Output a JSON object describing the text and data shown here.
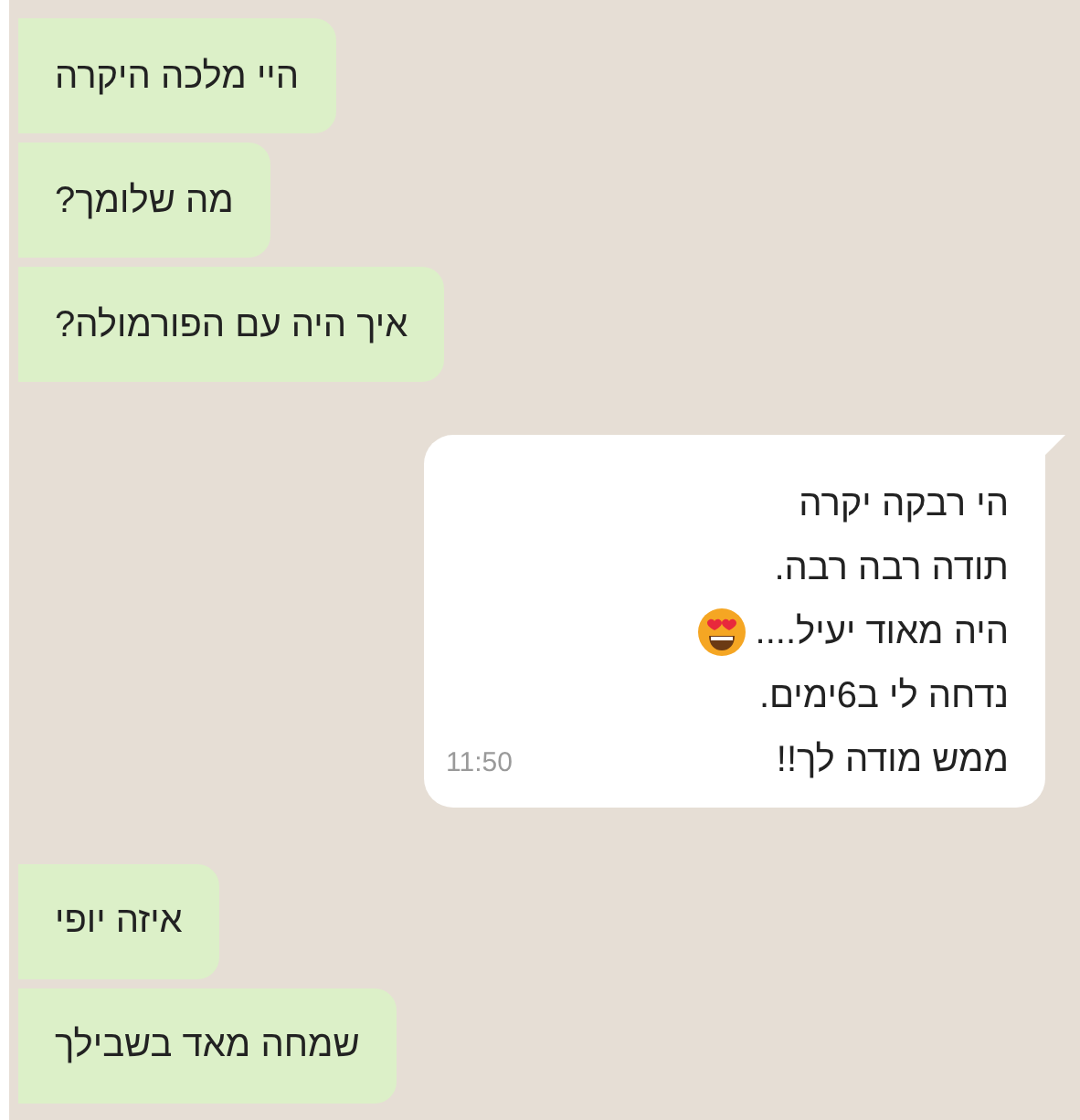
{
  "messages": [
    {
      "kind": "outgoing",
      "text": "היי מלכה היקרה"
    },
    {
      "kind": "outgoing",
      "text": "מה שלומך?"
    },
    {
      "kind": "outgoing",
      "text": "איך היה עם הפורמולה?"
    },
    {
      "kind": "incoming",
      "time": "11:50",
      "lines": [
        {
          "text": "הי רבקה יקרה",
          "has_emoji": false
        },
        {
          "text": "תודה רבה רבה.",
          "has_emoji": false
        },
        {
          "text": "היה מאוד יעיל....",
          "has_emoji": true
        },
        {
          "text": "נדחה לי ב6ימים.",
          "has_emoji": false
        },
        {
          "text": "ממש מודה לך!!",
          "has_emoji": false
        }
      ]
    },
    {
      "kind": "outgoing",
      "text": "איזה יופי"
    },
    {
      "kind": "outgoing",
      "text": "שמחה מאד בשבילך"
    }
  ]
}
